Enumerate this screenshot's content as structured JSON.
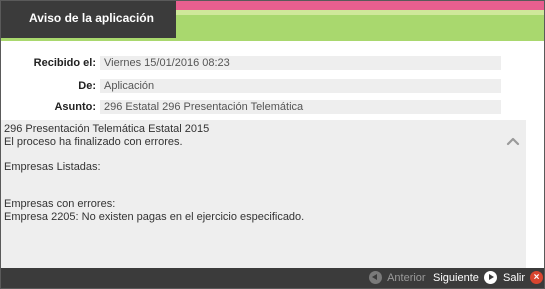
{
  "header": {
    "title": "Aviso de la aplicación"
  },
  "fields": {
    "received": {
      "label": "Recibido el:",
      "value": "Viernes 15/01/2016 08:23"
    },
    "from": {
      "label": "De:",
      "value": "Aplicación"
    },
    "subject": {
      "label": "Asunto:",
      "value": "296 Estatal 296 Presentación Telemática"
    }
  },
  "message": {
    "lines": [
      "296 Presentación Telemática Estatal 2015",
      "El proceso ha finalizado con errores.",
      "",
      "Empresas Listadas:",
      "",
      "",
      "Empresas con errores:",
      "Empresa 2205: No existen pagas en el ejercicio especificado."
    ]
  },
  "footer": {
    "prev_label": "Anterior",
    "next_label": "Siguiente",
    "exit_label": "Salir"
  },
  "icons": {
    "prev": "arrow-left-circle-icon",
    "next": "arrow-right-circle-icon",
    "exit": "close-circle-icon",
    "scroll": "chevron-up-icon"
  },
  "colors": {
    "header_dark": "#3b3b3b",
    "accent_pink": "#e85f8f",
    "accent_green": "#a9d86e",
    "close_red": "#d9452f",
    "panel_bg": "#eeeeee"
  }
}
